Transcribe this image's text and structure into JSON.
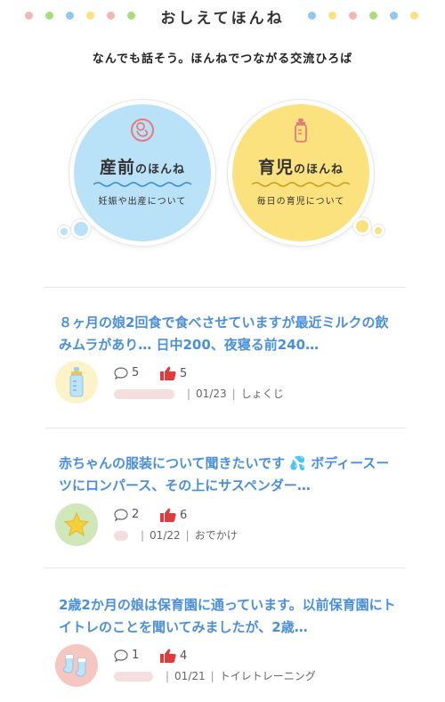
{
  "header": {
    "title": "おしえてほんね",
    "dot_colors": [
      "#f3b6b6",
      "#a8dd7c",
      "#8fc9ef",
      "#fbe27e",
      "#f3b6b6",
      "#a8dd7c"
    ]
  },
  "subtitle": "なんでも話そう。ほんねでつながる交流ひろば",
  "categories": [
    {
      "title_main": "産前",
      "title_suffix": "のほんね",
      "sub": "妊娠や出産について",
      "color": "#b9e1f7",
      "icon": "fetus-icon"
    },
    {
      "title_main": "育児",
      "title_suffix": "のほんね",
      "sub": "毎日の育児について",
      "color": "#fbe27e",
      "icon": "baby-bottle-icon"
    }
  ],
  "posts": [
    {
      "title": "８ヶ月の娘2回食で食べさせていますが最近ミルクの飲みムラがあり… 日中200、夜寝る前240…",
      "comments": "5",
      "likes": "5",
      "date": "01/23",
      "category": "しょくじ",
      "avatar_icon": "baby-bottle-icon",
      "avatar_color": "#fdf3c9"
    },
    {
      "title": "赤ちゃんの服装について聞きたいです 💦 ボディースーツにロンパース、その上にサスペンダー…",
      "comments": "2",
      "likes": "6",
      "date": "01/22",
      "category": "おでかけ",
      "avatar_icon": "star-icon",
      "avatar_color": "#cfe7b9"
    },
    {
      "title": "2歳2か月の娘は保育園に通っています。以前保育園にトイトレのことを聞いてみましたが、2歳…",
      "comments": "1",
      "likes": "4",
      "date": "01/21",
      "category": "トイレトレーニング",
      "avatar_icon": "socks-icon",
      "avatar_color": "#f6c7c0"
    }
  ]
}
